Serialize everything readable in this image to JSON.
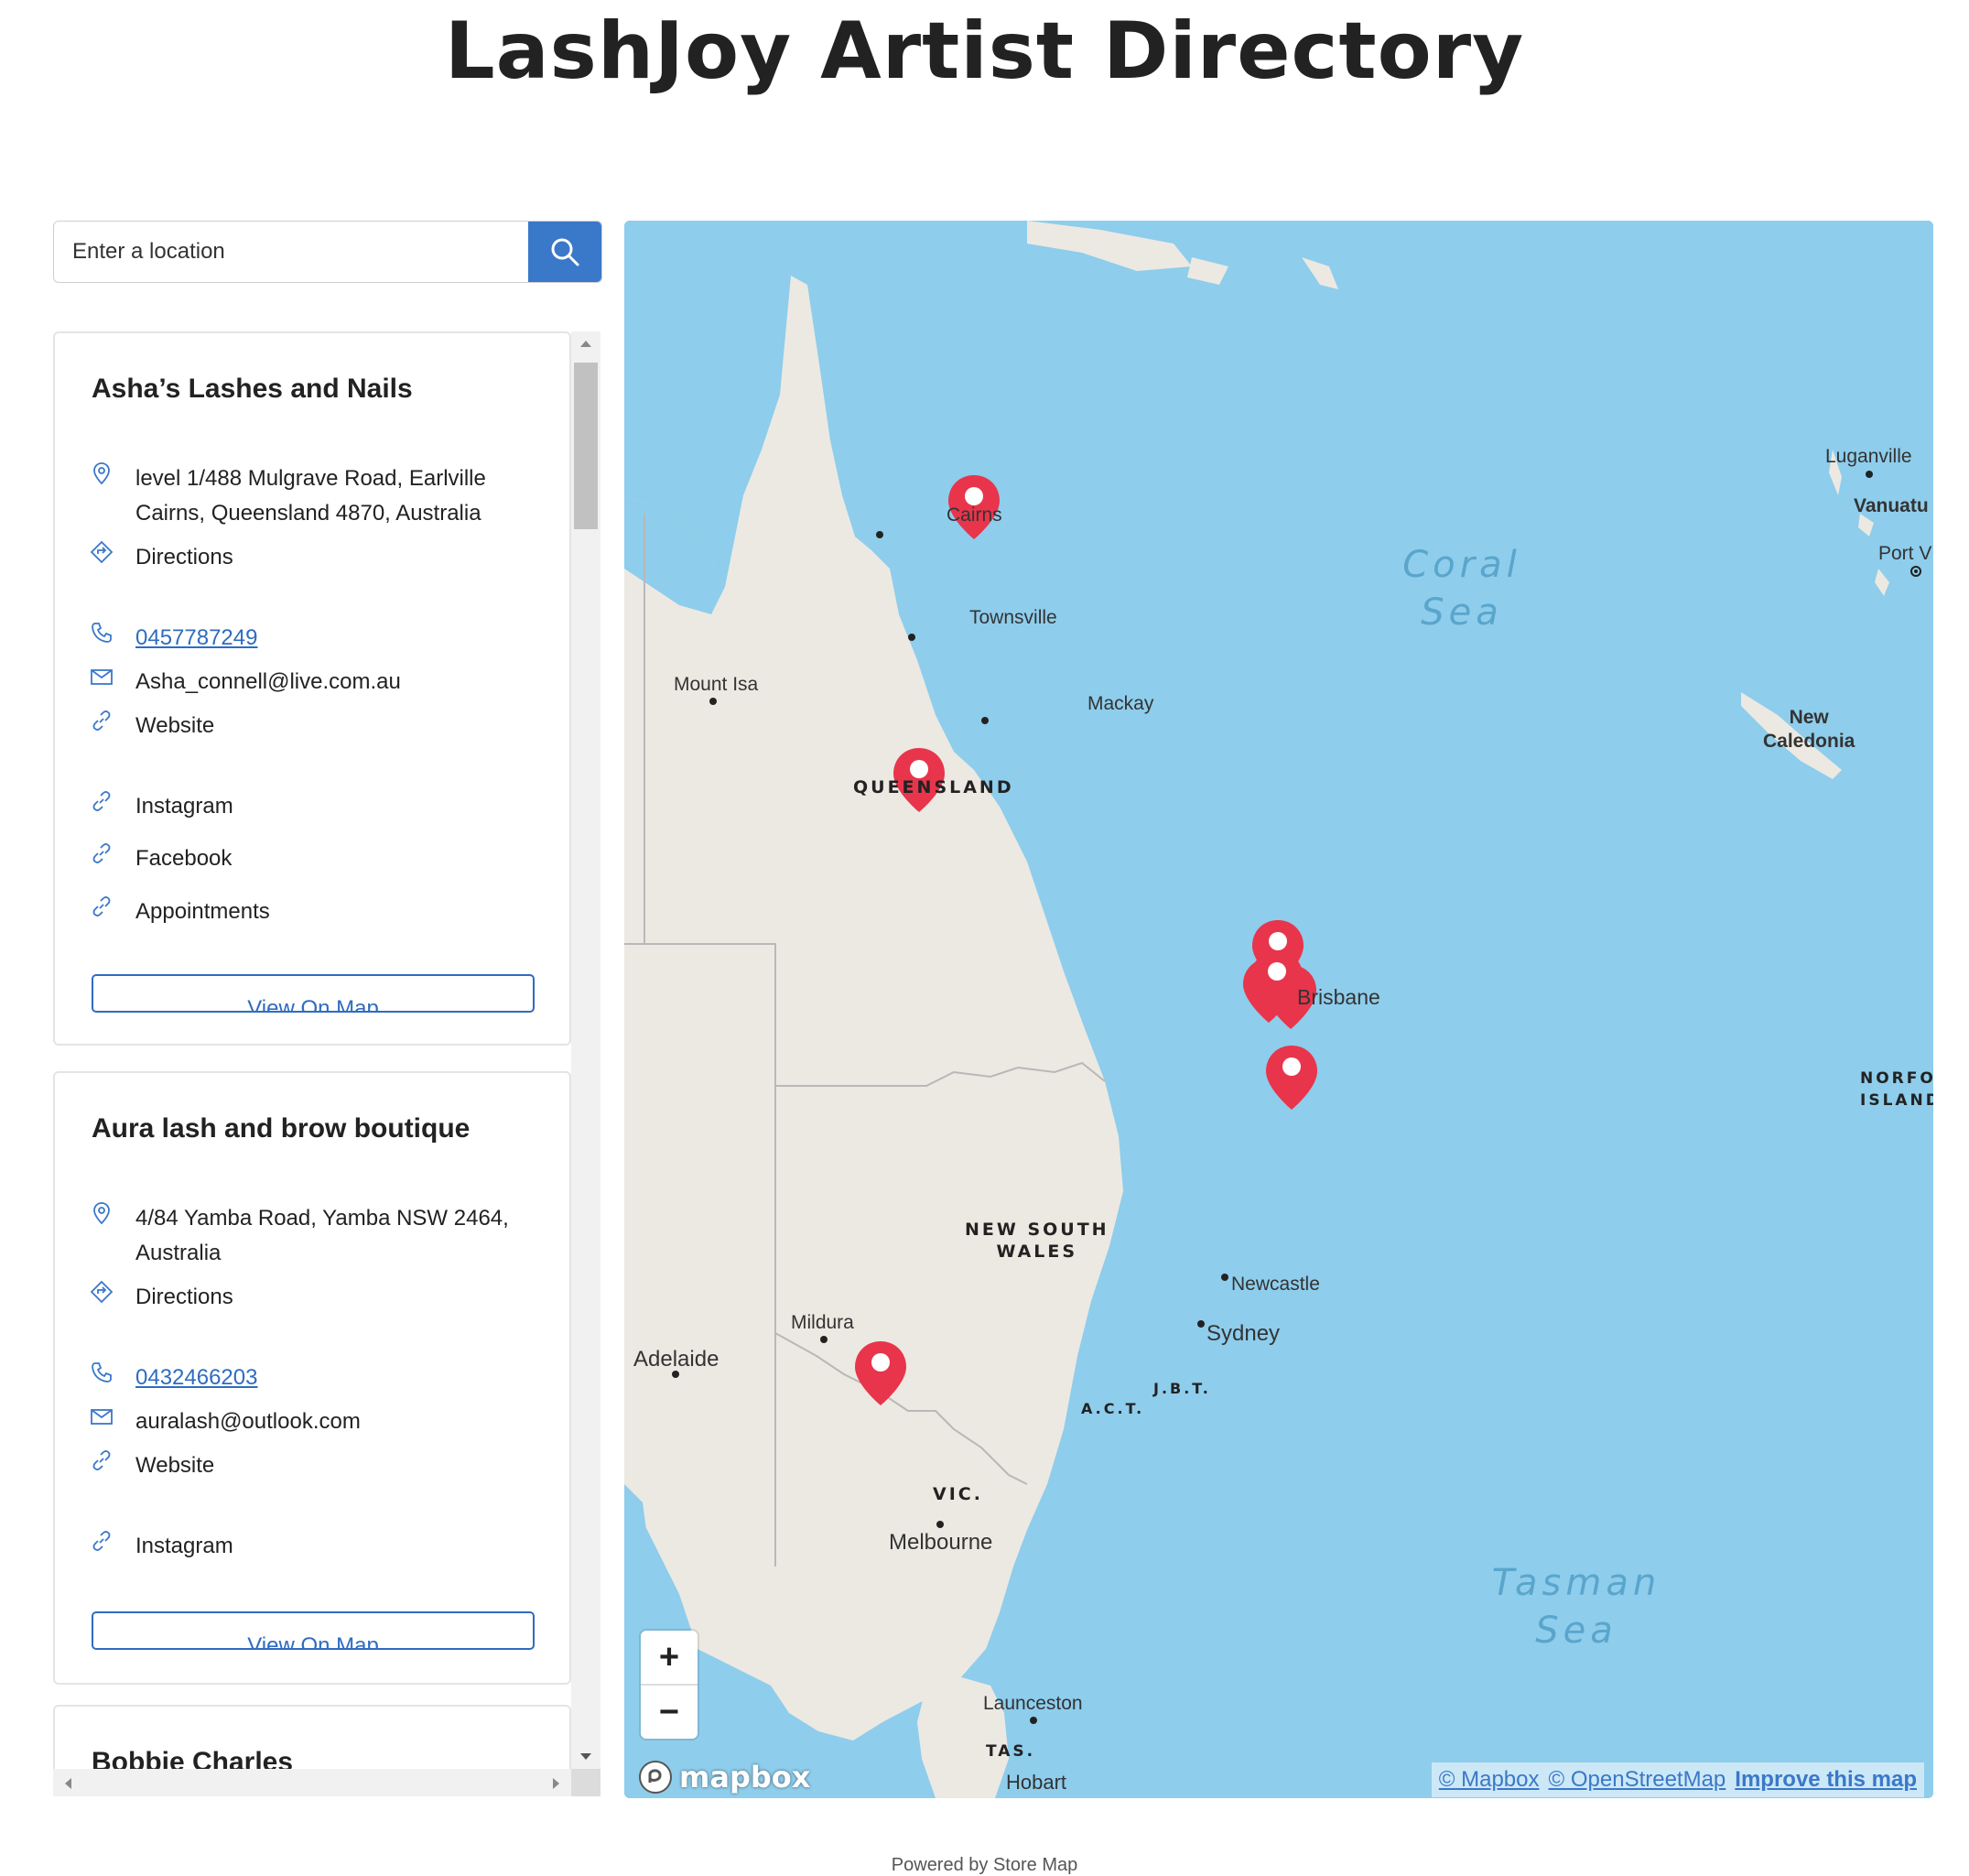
{
  "page_title": "LashJoy Artist Directory",
  "search": {
    "placeholder": "Enter a location"
  },
  "listings": [
    {
      "name": "Asha’s Lashes and Nails",
      "address": "level 1/488 Mulgrave Road, Earlville\nCairns, Queensland 4870, Australia",
      "directions": "Directions",
      "phone": "0457787249",
      "email": "Asha_connell@live.com.au",
      "website": "Website",
      "instagram": "Instagram",
      "facebook": "Facebook",
      "appointments": "Appointments",
      "view_label": "View On Map"
    },
    {
      "name": "Aura lash and brow boutique",
      "address": "4/84 Yamba Road, Yamba NSW 2464,\nAustralia",
      "directions": "Directions",
      "phone": "0432466203",
      "email": "auralash@outlook.com",
      "website": "Website",
      "instagram": "Instagram",
      "view_label": "View On Map"
    },
    {
      "name": "Bobbie Charles"
    }
  ],
  "map": {
    "labels": {
      "cairns": "Cairns",
      "townsville": "Townsville",
      "mount_isa": "Mount Isa",
      "mackay": "Mackay",
      "brisbane": "Brisbane",
      "newcastle": "Newcastle",
      "sydney": "Sydney",
      "mildura": "Mildura",
      "adelaide": "Adelaide",
      "melbourne": "Melbourne",
      "launceston": "Launceston",
      "hobart": "Hobart",
      "luganville": "Luganville",
      "vanuatu": "Vanuatu",
      "port_vila": "Port V",
      "new_caledonia": "New\nCaledonia",
      "norfolk_island": "NORFOL\nISLAND",
      "queensland": "QUEENSLAND",
      "nsw": "NEW SOUTH\nWALES",
      "vic": "VIC.",
      "act": "A.C.T.",
      "jbt": "J.B.T.",
      "tas": "TAS.",
      "coral_sea": "Coral\nSea",
      "tasman_sea": "Tasman\nSea"
    },
    "zoom_in": "+",
    "zoom_out": "−",
    "logo": "mapbox",
    "attribution": {
      "mapbox": "© Mapbox",
      "osm": "© OpenStreetMap",
      "improve": "Improve this map"
    },
    "colors": {
      "water": "#8ecdec",
      "land": "#ece9e2",
      "marker": "#e8354b",
      "accent": "#3a78c9"
    }
  },
  "footer": "Powered by Store Map"
}
